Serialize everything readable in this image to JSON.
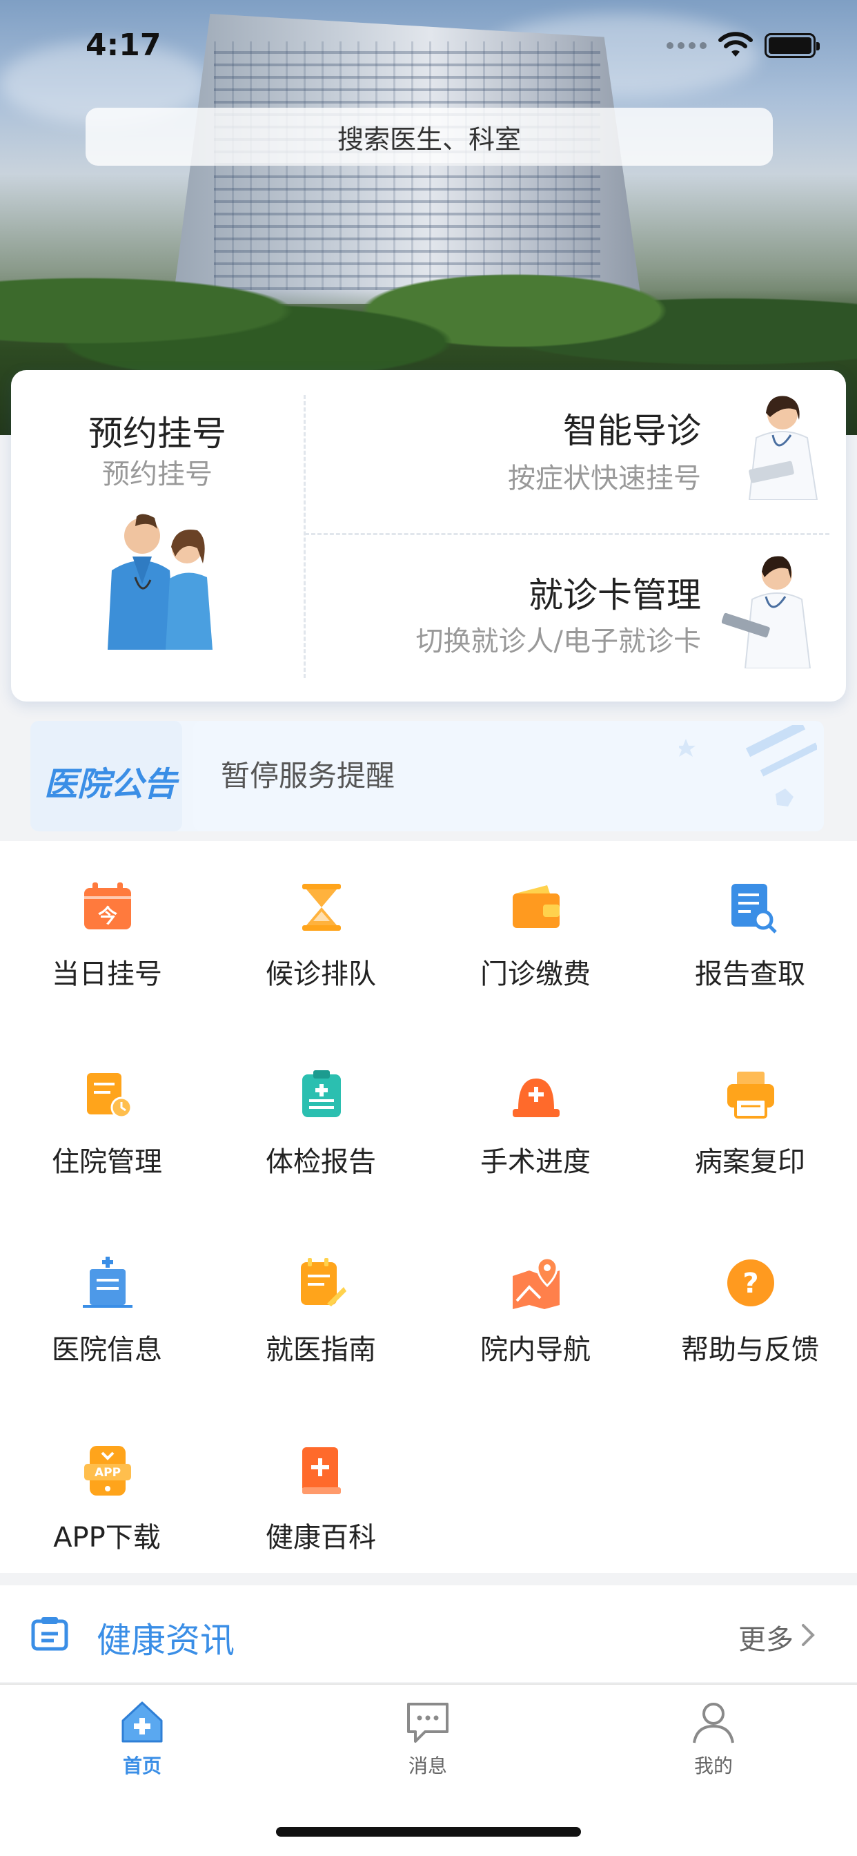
{
  "status_bar": {
    "time": "4:17"
  },
  "search": {
    "placeholder": "搜索医生、科室"
  },
  "main_card": {
    "appointment": {
      "title": "预约挂号",
      "subtitle": "预约挂号"
    },
    "smart_guide": {
      "title": "智能导诊",
      "subtitle": "按症状快速挂号"
    },
    "card_manage": {
      "title": "就诊卡管理",
      "subtitle": "切换就诊人/电子就诊卡"
    }
  },
  "notice": {
    "logo_text": "医院公告",
    "text": "暂停服务提醒"
  },
  "grid": [
    {
      "label": "当日挂号",
      "icon": "calendar-today-icon",
      "color": "#ff7a3d"
    },
    {
      "label": "候诊排队",
      "icon": "hourglass-icon",
      "color": "#ffa41b"
    },
    {
      "label": "门诊缴费",
      "icon": "wallet-icon",
      "color": "#ff9a1f"
    },
    {
      "label": "报告查取",
      "icon": "report-search-icon",
      "color": "#3a8ee6"
    },
    {
      "label": "住院管理",
      "icon": "inpatient-icon",
      "color": "#ffa41b"
    },
    {
      "label": "体检报告",
      "icon": "checkup-clipboard-icon",
      "color": "#2bbfb0"
    },
    {
      "label": "手术进度",
      "icon": "surgery-light-icon",
      "color": "#ff6a2b"
    },
    {
      "label": "病案复印",
      "icon": "printer-icon",
      "color": "#ffa41b"
    },
    {
      "label": "医院信息",
      "icon": "hospital-info-icon",
      "color": "#3a8ee6"
    },
    {
      "label": "就医指南",
      "icon": "guide-note-icon",
      "color": "#ffa41b"
    },
    {
      "label": "院内导航",
      "icon": "map-pin-icon",
      "color": "#ff6a2b"
    },
    {
      "label": "帮助与反馈",
      "icon": "help-icon",
      "color": "#ff9a1f"
    },
    {
      "label": "APP下载",
      "icon": "app-download-icon",
      "color": "#ffa41b"
    },
    {
      "label": "健康百科",
      "icon": "health-book-icon",
      "color": "#ff6a2b"
    }
  ],
  "news": {
    "title": "健康资讯",
    "more": "更多"
  },
  "tabs": [
    {
      "label": "首页",
      "icon": "home-icon",
      "active": true
    },
    {
      "label": "消息",
      "icon": "message-icon",
      "active": false
    },
    {
      "label": "我的",
      "icon": "profile-icon",
      "active": false
    }
  ],
  "colors": {
    "primary": "#3a8ee6",
    "accent_orange": "#ff9a1f",
    "text_gray": "#999999"
  }
}
